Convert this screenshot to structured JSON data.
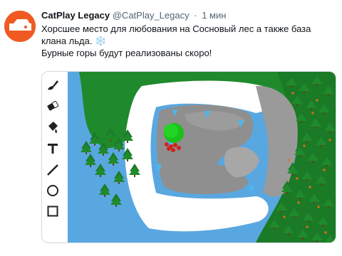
{
  "tweet": {
    "display_name": "CatPlay Legacy",
    "handle": "@CatPlay_Legacy",
    "separator": "·",
    "time": "1 мин",
    "line1": "Хорсшее место для любования на Сосновый лес а также база клана льда. ❄️",
    "line2": "Бурные горы будут реализованы скоро!"
  },
  "colors": {
    "brand": "#f05a22",
    "forest": "#1f8a2b",
    "lake": "#59a7e0",
    "rock": "#8f8f8f",
    "ice": "#4bb6f0"
  },
  "toolbar": {
    "tools": [
      "brush-icon",
      "eraser-icon",
      "fill-bucket-icon",
      "text-tool-icon",
      "line-tool-icon",
      "ellipse-tool-icon",
      "rectangle-tool-icon"
    ]
  }
}
